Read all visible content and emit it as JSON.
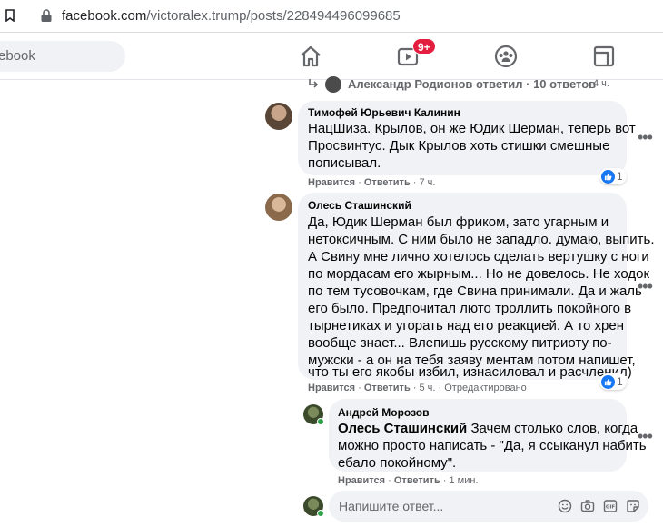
{
  "browser": {
    "url_host": "facebook.com",
    "url_path": "/victoralex.trump/posts/228494496099685"
  },
  "header": {
    "search_text": "ebook",
    "watch_badge": "9+",
    "icons": [
      "home-icon",
      "watch-icon",
      "groups-icon",
      "gaming-icon"
    ]
  },
  "thread_reply": {
    "name": "Александр Родионов",
    "text": "ответил · 10 ответов",
    "time": "4 ч."
  },
  "comments": [
    {
      "author": "Тимофей Юрьевич Калинин",
      "lines": [
        "НацШиза. Крылов, он же Юдик Шерман, теперь вот",
        "Просвинтус. Дык Крылов хоть стишки смешные",
        "пописывал."
      ],
      "like": "Нравится",
      "reply": "Ответить",
      "time": "7 ч.",
      "reactions": "1"
    },
    {
      "author": "Олесь Сташинский",
      "lines": [
        "Да, Юдик Шерман был фриком, зато угарным и",
        "нетоксичным. С ним было не западло. думаю, выпить.",
        "А Свину мне лично хотелось сделать вертушку с ноги",
        "по мордасам его жырным... Но не довелось. Не ходок",
        "по тем тусовочкам, где Свина принимали. Да и жаль",
        "его было. Предпочитал люто троллить покойного в",
        "тырнетиках и угорать над его реакцией. А то хрен",
        "вообще знает... Влепишь русскому питриоту по-",
        "мужски - а он на тебя заяву ментам потом напишет,",
        "что ты его якобы избил, изнасиловал и расчленил)"
      ],
      "like": "Нравится",
      "reply": "Ответить",
      "time": "5 ч.",
      "edited": "Отредактировано",
      "reactions": "1"
    },
    {
      "author": "Андрей Морозов",
      "mention": "Олесь Сташинский",
      "lines": [
        "Зачем столько слов, когда",
        "можно просто написать - \"Да, я ссыканул набить",
        "ебало покойному\"."
      ],
      "like": "Нравится",
      "reply": "Ответить",
      "time": "1 мин."
    }
  ],
  "reply_input": {
    "placeholder": "Напишите ответ..."
  },
  "colors": {
    "facebook_blue": "#1877f2",
    "badge_red": "#e41e3f",
    "bubble_gray": "#f0f2f5",
    "secondary_text": "#65676b"
  }
}
